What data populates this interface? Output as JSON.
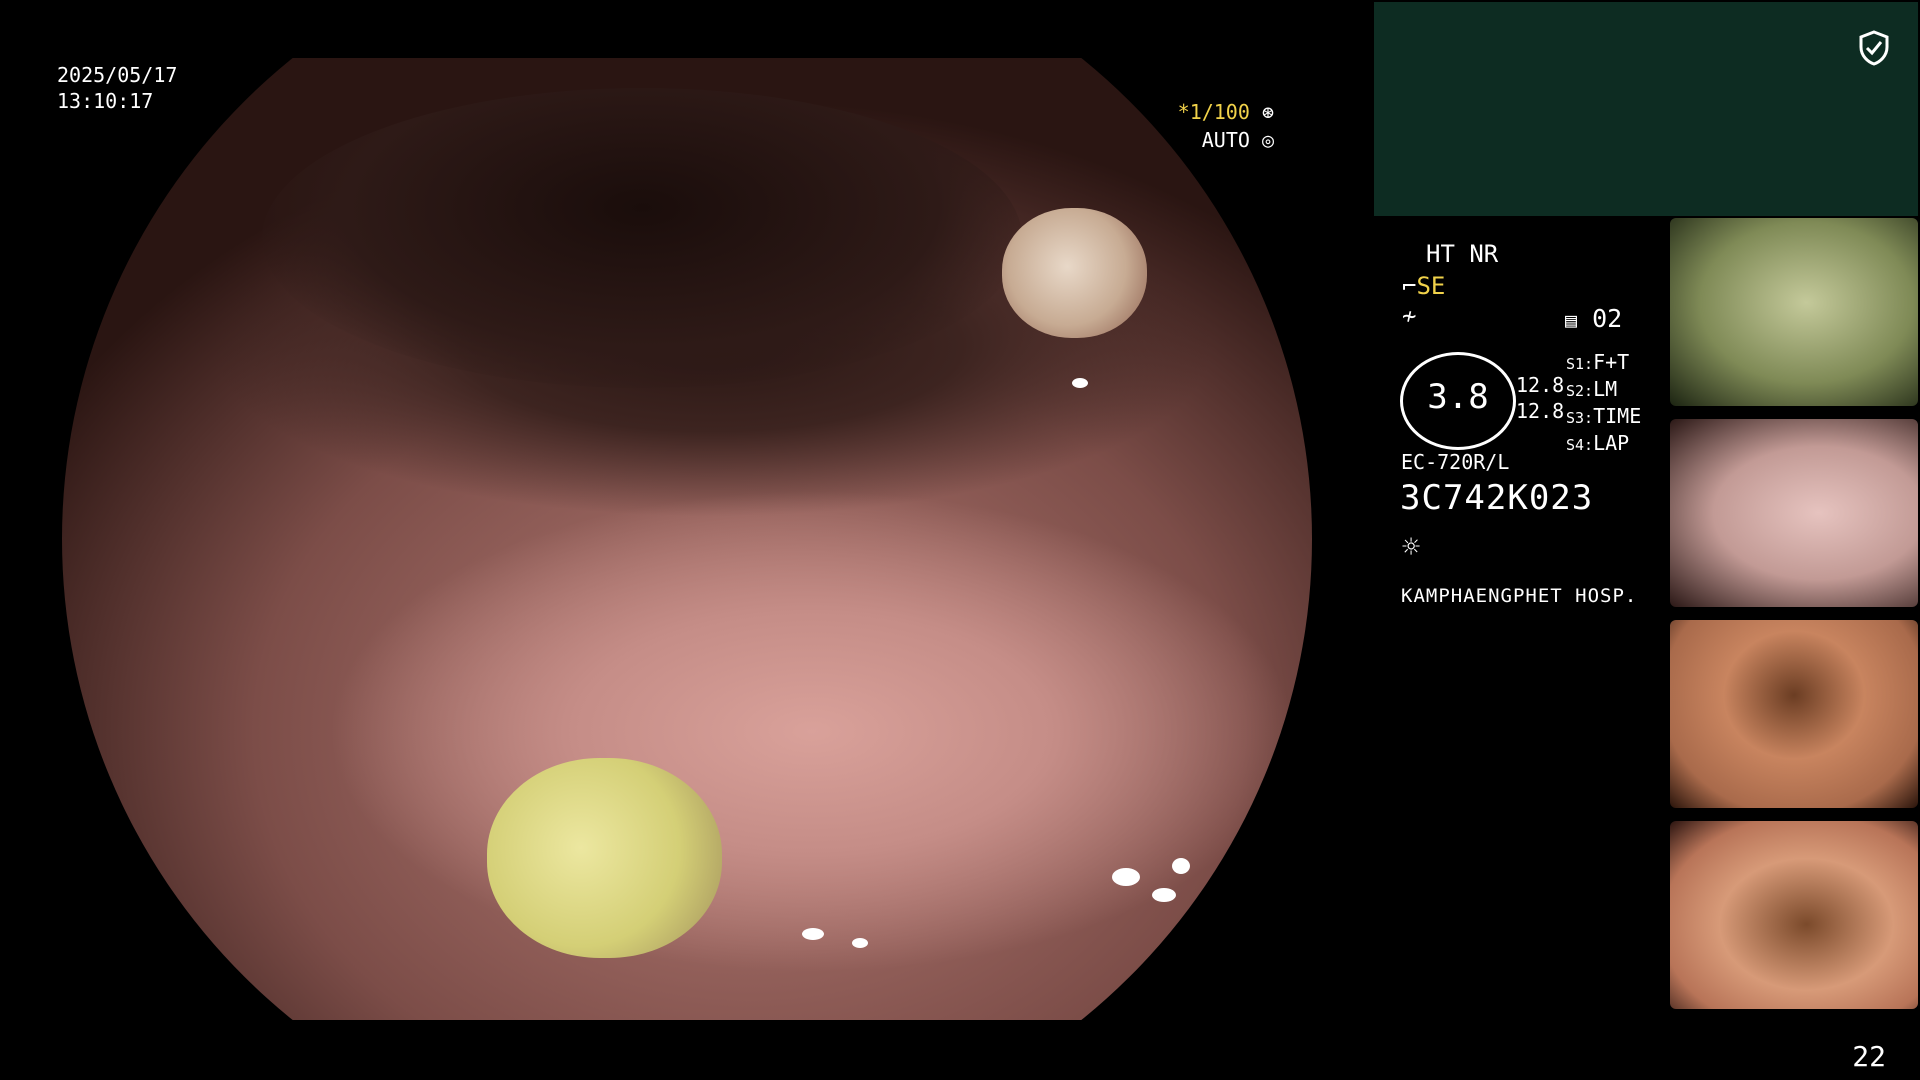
{
  "overlay": {
    "date": "2025/05/17",
    "time": "13:10:17",
    "shutter_star": "*",
    "shutter": "1/100",
    "iris": "AUTO"
  },
  "panel": {
    "ht_nr": "HT NR",
    "se": "SE",
    "record_count": "02",
    "meter_value": "3.8",
    "side_value_1": "12.8",
    "side_value_2": "12.8",
    "slots": [
      {
        "label": "S1:",
        "value": "F+T"
      },
      {
        "label": "S2:",
        "value": "LM"
      },
      {
        "label": "S3:",
        "value": "TIME"
      },
      {
        "label": "S4:",
        "value": "LAP"
      }
    ],
    "model": "EC-720R/L",
    "serial": "3C742K023",
    "hospital": "KAMPHAENGPHET HOSP."
  },
  "page_number": "22",
  "icons": [
    "shield-check-icon",
    "aperture-icon",
    "scope-bend-icon",
    "no-signal-icon",
    "memory-icon",
    "light-icon"
  ],
  "colors": {
    "panel_bg": "#0d2c22",
    "highlight_yellow": "#f1d24a"
  }
}
